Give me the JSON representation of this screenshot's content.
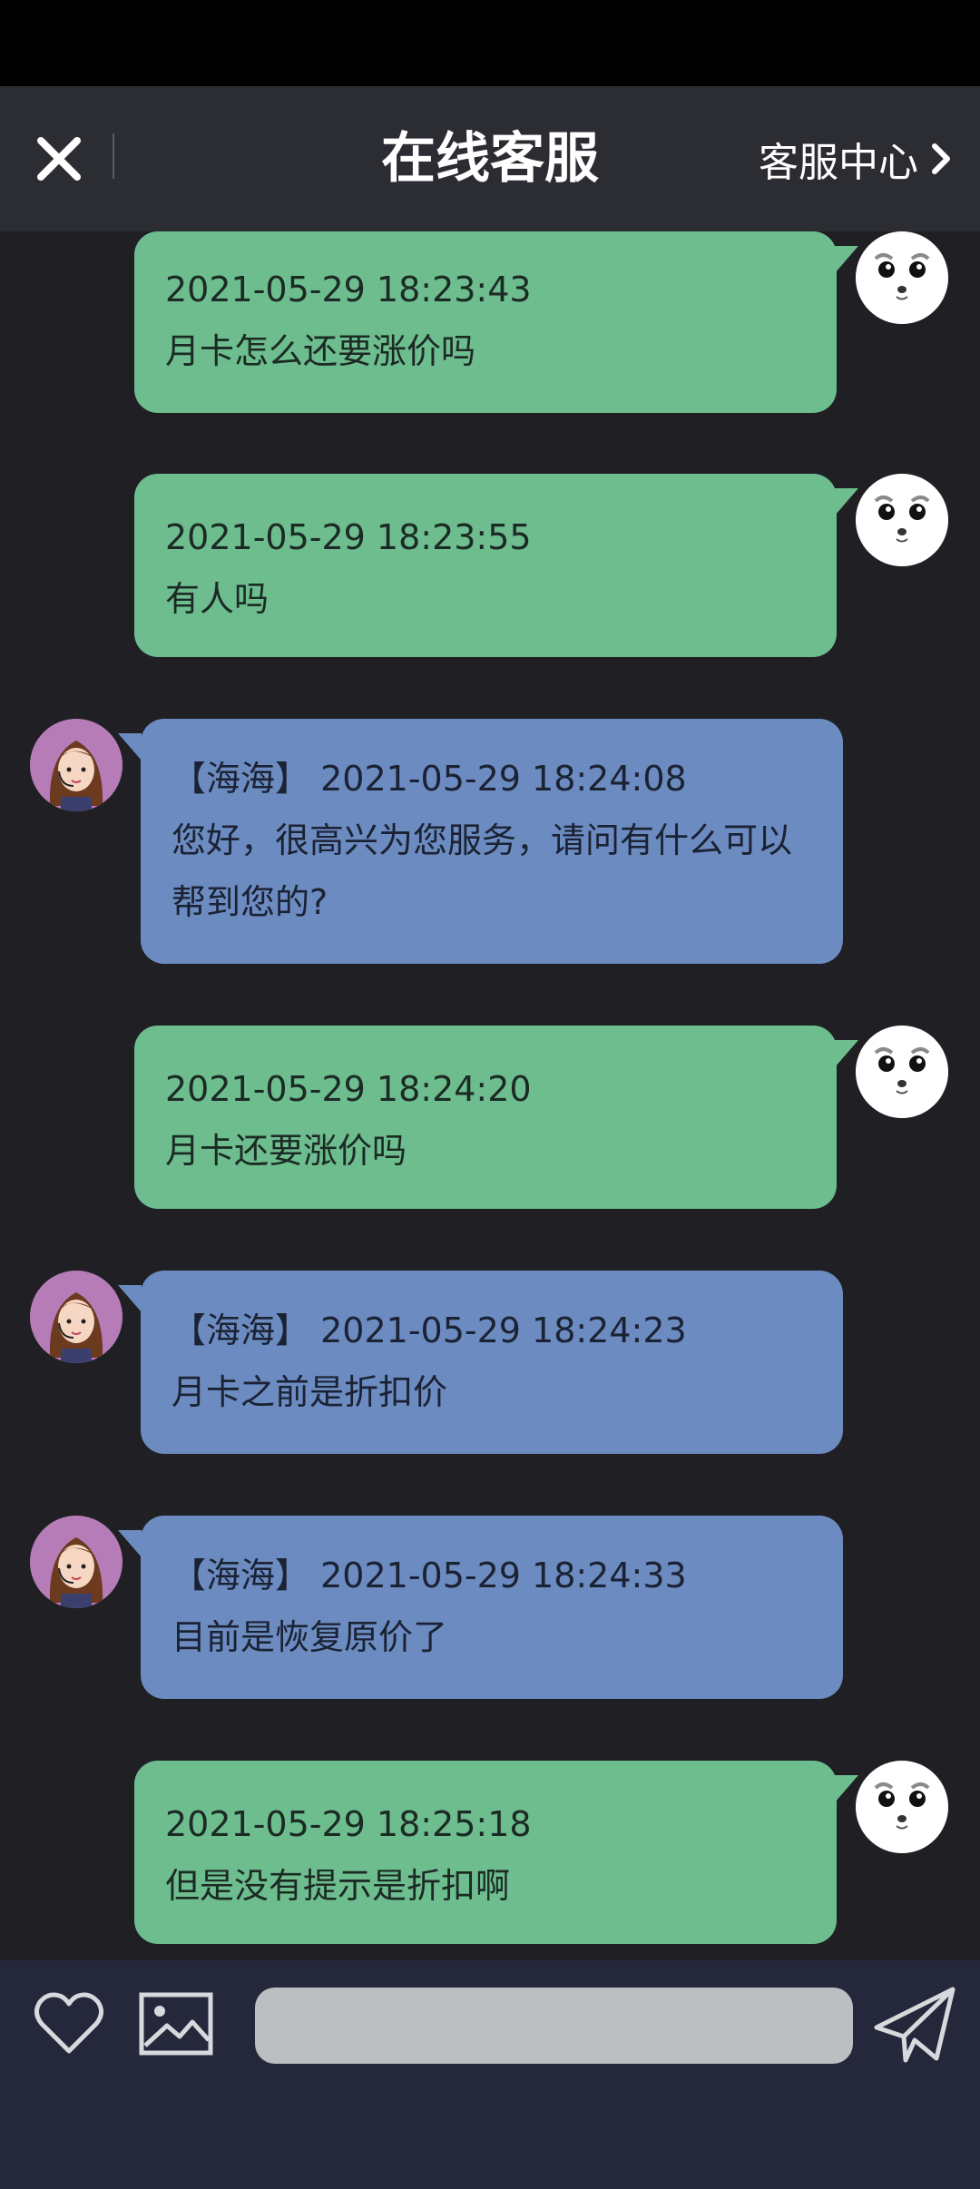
{
  "header": {
    "title": "在线客服",
    "service_center_label": "客服中心"
  },
  "messages": [
    {
      "sender": "user",
      "timestamp": "2021-05-29 18:23:43",
      "text": "月卡怎么还要涨价吗"
    },
    {
      "sender": "user",
      "timestamp": "2021-05-29 18:23:55",
      "text": "有人吗"
    },
    {
      "sender": "agent",
      "agent_name": "【海海】",
      "timestamp": "2021-05-29 18:24:08",
      "text": "您好，很高兴为您服务，请问有什么可以帮到您的?"
    },
    {
      "sender": "user",
      "timestamp": "2021-05-29 18:24:20",
      "text": "月卡还要涨价吗"
    },
    {
      "sender": "agent",
      "agent_name": "【海海】",
      "timestamp": "2021-05-29 18:24:23",
      "text": "月卡之前是折扣价"
    },
    {
      "sender": "agent",
      "agent_name": "【海海】",
      "timestamp": "2021-05-29 18:24:33",
      "text": "目前是恢复原价了"
    },
    {
      "sender": "user",
      "timestamp": "2021-05-29 18:25:18",
      "text": "但是没有提示是折扣啊"
    }
  ],
  "composer": {
    "input_value": "",
    "input_placeholder": ""
  },
  "colors": {
    "user_bubble": "#6dbd8f",
    "agent_bubble": "#6c8bc0",
    "background": "#1f1f24",
    "header": "#2c2d33",
    "footer": "#24283a"
  },
  "icons": {
    "close": "close-icon",
    "chevron": "chevron-right-icon",
    "favorite": "heart-icon",
    "image": "image-icon",
    "send": "paper-plane-icon"
  }
}
